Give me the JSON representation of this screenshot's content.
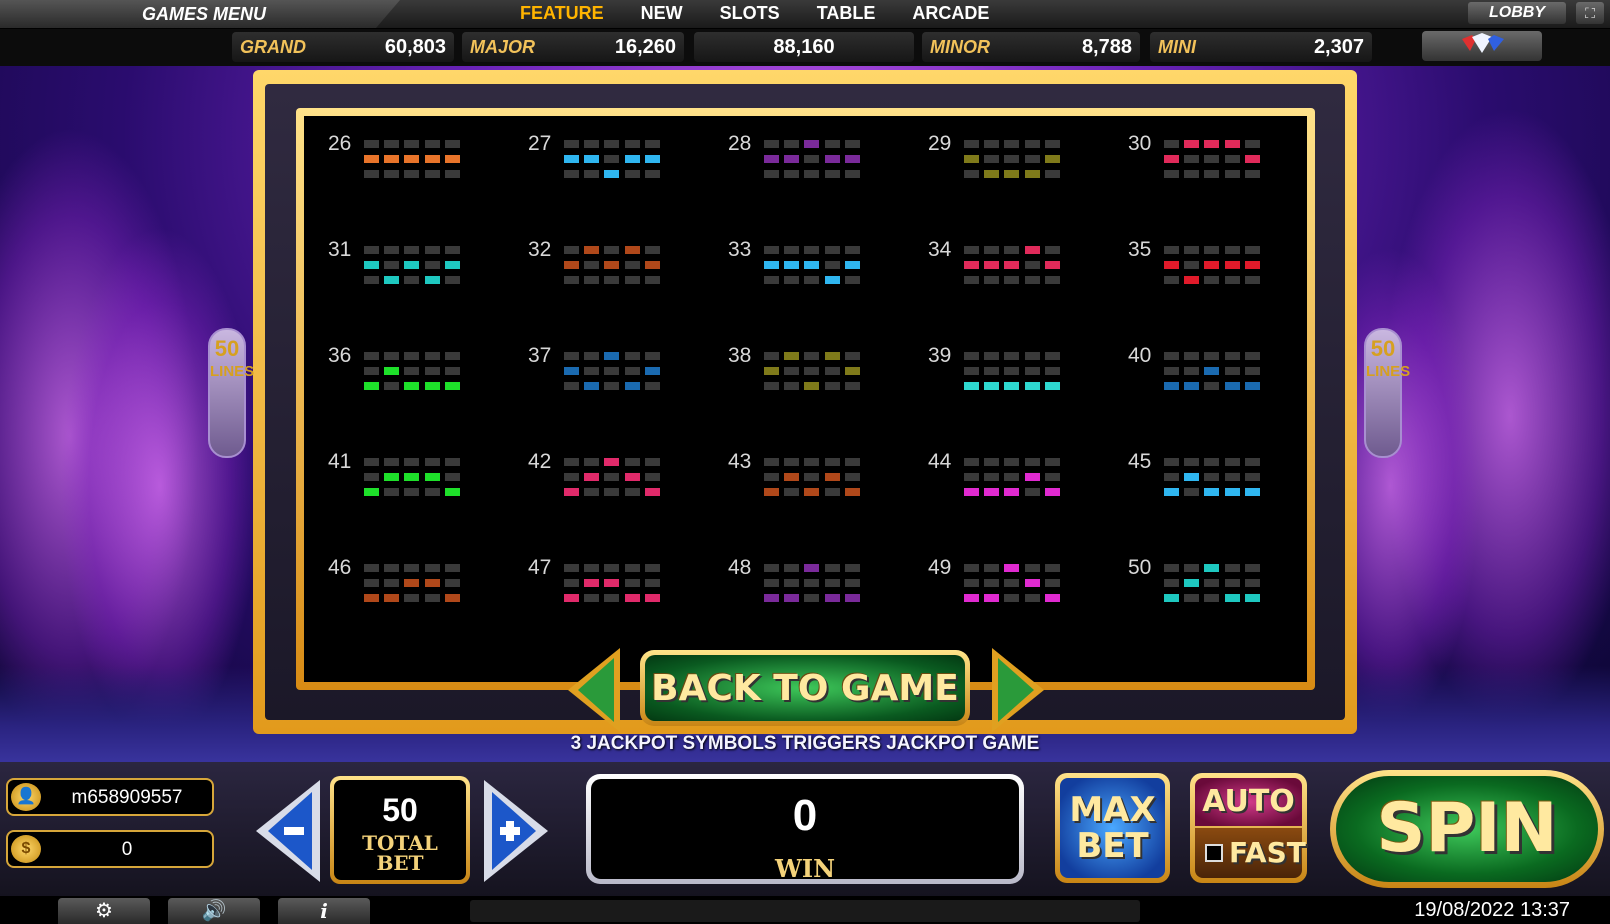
{
  "top_nav": {
    "games_menu": "GAMES MENU",
    "tabs": [
      {
        "label": "FEATURE",
        "active": true
      },
      {
        "label": "NEW",
        "active": false
      },
      {
        "label": "SLOTS",
        "active": false
      },
      {
        "label": "TABLE",
        "active": false
      },
      {
        "label": "ARCADE",
        "active": false
      }
    ],
    "lobby": "LOBBY",
    "fullscreen_icon": "fullscreen-icon"
  },
  "jackpots": {
    "grand": {
      "label": "GRAND",
      "value": "60,803"
    },
    "major": {
      "label": "MAJOR",
      "value": "16,260"
    },
    "center": {
      "value": "88,160"
    },
    "minor": {
      "label": "MINOR",
      "value": "8,788"
    },
    "mini": {
      "label": "MINI",
      "value": "2,307"
    },
    "diamond_icon": "diamond-icon"
  },
  "side_badge": {
    "number": "50",
    "word": "LINES"
  },
  "paylines": [
    {
      "num": "26",
      "color": "#e8742a",
      "rows": [
        1,
        1,
        1,
        1,
        1
      ]
    },
    {
      "num": "27",
      "color": "#2fb6f0",
      "rows": [
        1,
        1,
        2,
        1,
        1
      ]
    },
    {
      "num": "28",
      "color": "#7a2a9a",
      "rows": [
        1,
        1,
        0,
        1,
        1
      ]
    },
    {
      "num": "29",
      "color": "#7f7a1a",
      "rows": [
        1,
        2,
        2,
        2,
        1
      ]
    },
    {
      "num": "30",
      "color": "#e02a5a",
      "rows": [
        1,
        0,
        0,
        0,
        1
      ]
    },
    {
      "num": "31",
      "color": "#1ec8c0",
      "rows": [
        1,
        2,
        1,
        2,
        1
      ]
    },
    {
      "num": "32",
      "color": "#b0481a",
      "rows": [
        1,
        0,
        1,
        0,
        1
      ]
    },
    {
      "num": "33",
      "color": "#2fb6f0",
      "rows": [
        1,
        1,
        1,
        2,
        1
      ]
    },
    {
      "num": "34",
      "color": "#e02a5a",
      "rows": [
        1,
        1,
        1,
        0,
        1
      ]
    },
    {
      "num": "35",
      "color": "#e01a2a",
      "rows": [
        1,
        2,
        1,
        1,
        1
      ]
    },
    {
      "num": "36",
      "color": "#1ee02a",
      "rows": [
        2,
        1,
        2,
        2,
        2
      ]
    },
    {
      "num": "37",
      "color": "#1a6ab0",
      "rows": [
        1,
        2,
        0,
        2,
        1
      ]
    },
    {
      "num": "38",
      "color": "#7f7a1a",
      "rows": [
        1,
        0,
        2,
        0,
        1
      ]
    },
    {
      "num": "39",
      "color": "#2ed8d0",
      "rows": [
        2,
        2,
        2,
        2,
        2
      ]
    },
    {
      "num": "40",
      "color": "#1a6ab0",
      "rows": [
        2,
        2,
        1,
        2,
        2
      ]
    },
    {
      "num": "41",
      "color": "#1ee02a",
      "rows": [
        2,
        1,
        1,
        1,
        2
      ]
    },
    {
      "num": "42",
      "color": "#e02a6a",
      "rows": [
        2,
        1,
        0,
        1,
        2
      ]
    },
    {
      "num": "43",
      "color": "#b0481a",
      "rows": [
        2,
        1,
        2,
        1,
        2
      ]
    },
    {
      "num": "44",
      "color": "#e02ad0",
      "rows": [
        2,
        2,
        2,
        1,
        2
      ]
    },
    {
      "num": "45",
      "color": "#2fb6f0",
      "rows": [
        2,
        1,
        2,
        2,
        2
      ]
    },
    {
      "num": "46",
      "color": "#b0481a",
      "rows": [
        2,
        2,
        1,
        1,
        2
      ]
    },
    {
      "num": "47",
      "color": "#e02a6a",
      "rows": [
        2,
        1,
        1,
        2,
        2
      ]
    },
    {
      "num": "48",
      "color": "#7a2a9a",
      "rows": [
        2,
        2,
        0,
        2,
        2
      ]
    },
    {
      "num": "49",
      "color": "#e02ad0",
      "rows": [
        2,
        2,
        0,
        1,
        2
      ]
    },
    {
      "num": "50",
      "color": "#1ec8c0",
      "rows": [
        2,
        1,
        0,
        2,
        2
      ]
    }
  ],
  "back_to_game": "BACK TO GAME",
  "jackpot_hint": "3 JACKPOT SYMBOLS TRIGGERS JACKPOT GAME",
  "account": {
    "username": "m658909557",
    "user_icon": "user-icon",
    "balance": "0",
    "coin_icon": "coin-icon"
  },
  "bet": {
    "decrease_icon": "minus-icon",
    "increase_icon": "plus-icon",
    "total_bet_value": "50",
    "total_bet_label": "TOTAL\nBET"
  },
  "win": {
    "value": "0",
    "label": "WIN"
  },
  "max_bet": "MAX\nBET",
  "auto": "AUTO",
  "fast": "FAST",
  "spin": "SPIN",
  "footer": {
    "settings_icon": "gear-icon",
    "sound_icon": "speaker-icon",
    "info_icon": "info-icon",
    "datetime": "19/08/2022 13:37"
  }
}
